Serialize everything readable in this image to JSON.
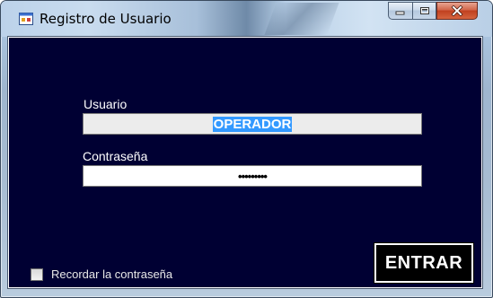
{
  "window": {
    "title": "Registro de Usuario"
  },
  "form": {
    "user_label": "Usuario",
    "user_value": "OPERADOR",
    "password_label": "Contraseña",
    "password_mask": "•••••••••",
    "remember_label": "Recordar la contraseña",
    "remember_checked": false,
    "submit_label": "ENTRAR"
  },
  "colors": {
    "client_background": "#000033",
    "selection": "#3399ff",
    "close_button": "#c94b2c"
  },
  "icons": {
    "app": "application-icon",
    "minimize": "minimize-icon",
    "maximize": "maximize-icon",
    "close": "close-icon"
  }
}
